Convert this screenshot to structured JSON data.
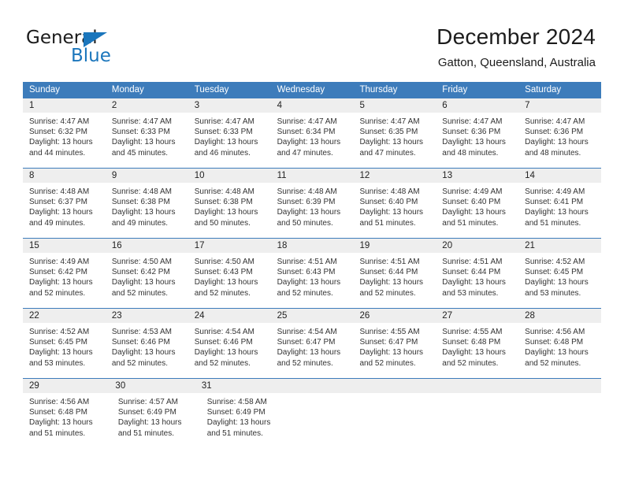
{
  "brand": {
    "name_dark": "General",
    "name_light": "Blue",
    "triangle_color": "#1b76bc",
    "dark_color": "#1a1a1a"
  },
  "header": {
    "title": "December 2024",
    "subtitle": "Gatton, Queensland, Australia"
  },
  "theme": {
    "header_blue": "#3d7cbb",
    "daynum_band": "#eeeeee",
    "text": "#222222"
  },
  "weekdays": [
    "Sunday",
    "Monday",
    "Tuesday",
    "Wednesday",
    "Thursday",
    "Friday",
    "Saturday"
  ],
  "weeks": [
    [
      {
        "day": "1",
        "sunrise": "Sunrise: 4:47 AM",
        "sunset": "Sunset: 6:32 PM",
        "daylight1": "Daylight: 13 hours",
        "daylight2": "and 44 minutes."
      },
      {
        "day": "2",
        "sunrise": "Sunrise: 4:47 AM",
        "sunset": "Sunset: 6:33 PM",
        "daylight1": "Daylight: 13 hours",
        "daylight2": "and 45 minutes."
      },
      {
        "day": "3",
        "sunrise": "Sunrise: 4:47 AM",
        "sunset": "Sunset: 6:33 PM",
        "daylight1": "Daylight: 13 hours",
        "daylight2": "and 46 minutes."
      },
      {
        "day": "4",
        "sunrise": "Sunrise: 4:47 AM",
        "sunset": "Sunset: 6:34 PM",
        "daylight1": "Daylight: 13 hours",
        "daylight2": "and 47 minutes."
      },
      {
        "day": "5",
        "sunrise": "Sunrise: 4:47 AM",
        "sunset": "Sunset: 6:35 PM",
        "daylight1": "Daylight: 13 hours",
        "daylight2": "and 47 minutes."
      },
      {
        "day": "6",
        "sunrise": "Sunrise: 4:47 AM",
        "sunset": "Sunset: 6:36 PM",
        "daylight1": "Daylight: 13 hours",
        "daylight2": "and 48 minutes."
      },
      {
        "day": "7",
        "sunrise": "Sunrise: 4:47 AM",
        "sunset": "Sunset: 6:36 PM",
        "daylight1": "Daylight: 13 hours",
        "daylight2": "and 48 minutes."
      }
    ],
    [
      {
        "day": "8",
        "sunrise": "Sunrise: 4:48 AM",
        "sunset": "Sunset: 6:37 PM",
        "daylight1": "Daylight: 13 hours",
        "daylight2": "and 49 minutes."
      },
      {
        "day": "9",
        "sunrise": "Sunrise: 4:48 AM",
        "sunset": "Sunset: 6:38 PM",
        "daylight1": "Daylight: 13 hours",
        "daylight2": "and 49 minutes."
      },
      {
        "day": "10",
        "sunrise": "Sunrise: 4:48 AM",
        "sunset": "Sunset: 6:38 PM",
        "daylight1": "Daylight: 13 hours",
        "daylight2": "and 50 minutes."
      },
      {
        "day": "11",
        "sunrise": "Sunrise: 4:48 AM",
        "sunset": "Sunset: 6:39 PM",
        "daylight1": "Daylight: 13 hours",
        "daylight2": "and 50 minutes."
      },
      {
        "day": "12",
        "sunrise": "Sunrise: 4:48 AM",
        "sunset": "Sunset: 6:40 PM",
        "daylight1": "Daylight: 13 hours",
        "daylight2": "and 51 minutes."
      },
      {
        "day": "13",
        "sunrise": "Sunrise: 4:49 AM",
        "sunset": "Sunset: 6:40 PM",
        "daylight1": "Daylight: 13 hours",
        "daylight2": "and 51 minutes."
      },
      {
        "day": "14",
        "sunrise": "Sunrise: 4:49 AM",
        "sunset": "Sunset: 6:41 PM",
        "daylight1": "Daylight: 13 hours",
        "daylight2": "and 51 minutes."
      }
    ],
    [
      {
        "day": "15",
        "sunrise": "Sunrise: 4:49 AM",
        "sunset": "Sunset: 6:42 PM",
        "daylight1": "Daylight: 13 hours",
        "daylight2": "and 52 minutes."
      },
      {
        "day": "16",
        "sunrise": "Sunrise: 4:50 AM",
        "sunset": "Sunset: 6:42 PM",
        "daylight1": "Daylight: 13 hours",
        "daylight2": "and 52 minutes."
      },
      {
        "day": "17",
        "sunrise": "Sunrise: 4:50 AM",
        "sunset": "Sunset: 6:43 PM",
        "daylight1": "Daylight: 13 hours",
        "daylight2": "and 52 minutes."
      },
      {
        "day": "18",
        "sunrise": "Sunrise: 4:51 AM",
        "sunset": "Sunset: 6:43 PM",
        "daylight1": "Daylight: 13 hours",
        "daylight2": "and 52 minutes."
      },
      {
        "day": "19",
        "sunrise": "Sunrise: 4:51 AM",
        "sunset": "Sunset: 6:44 PM",
        "daylight1": "Daylight: 13 hours",
        "daylight2": "and 52 minutes."
      },
      {
        "day": "20",
        "sunrise": "Sunrise: 4:51 AM",
        "sunset": "Sunset: 6:44 PM",
        "daylight1": "Daylight: 13 hours",
        "daylight2": "and 53 minutes."
      },
      {
        "day": "21",
        "sunrise": "Sunrise: 4:52 AM",
        "sunset": "Sunset: 6:45 PM",
        "daylight1": "Daylight: 13 hours",
        "daylight2": "and 53 minutes."
      }
    ],
    [
      {
        "day": "22",
        "sunrise": "Sunrise: 4:52 AM",
        "sunset": "Sunset: 6:45 PM",
        "daylight1": "Daylight: 13 hours",
        "daylight2": "and 53 minutes."
      },
      {
        "day": "23",
        "sunrise": "Sunrise: 4:53 AM",
        "sunset": "Sunset: 6:46 PM",
        "daylight1": "Daylight: 13 hours",
        "daylight2": "and 52 minutes."
      },
      {
        "day": "24",
        "sunrise": "Sunrise: 4:54 AM",
        "sunset": "Sunset: 6:46 PM",
        "daylight1": "Daylight: 13 hours",
        "daylight2": "and 52 minutes."
      },
      {
        "day": "25",
        "sunrise": "Sunrise: 4:54 AM",
        "sunset": "Sunset: 6:47 PM",
        "daylight1": "Daylight: 13 hours",
        "daylight2": "and 52 minutes."
      },
      {
        "day": "26",
        "sunrise": "Sunrise: 4:55 AM",
        "sunset": "Sunset: 6:47 PM",
        "daylight1": "Daylight: 13 hours",
        "daylight2": "and 52 minutes."
      },
      {
        "day": "27",
        "sunrise": "Sunrise: 4:55 AM",
        "sunset": "Sunset: 6:48 PM",
        "daylight1": "Daylight: 13 hours",
        "daylight2": "and 52 minutes."
      },
      {
        "day": "28",
        "sunrise": "Sunrise: 4:56 AM",
        "sunset": "Sunset: 6:48 PM",
        "daylight1": "Daylight: 13 hours",
        "daylight2": "and 52 minutes."
      }
    ],
    [
      {
        "day": "29",
        "sunrise": "Sunrise: 4:56 AM",
        "sunset": "Sunset: 6:48 PM",
        "daylight1": "Daylight: 13 hours",
        "daylight2": "and 51 minutes."
      },
      {
        "day": "30",
        "sunrise": "Sunrise: 4:57 AM",
        "sunset": "Sunset: 6:49 PM",
        "daylight1": "Daylight: 13 hours",
        "daylight2": "and 51 minutes."
      },
      {
        "day": "31",
        "sunrise": "Sunrise: 4:58 AM",
        "sunset": "Sunset: 6:49 PM",
        "daylight1": "Daylight: 13 hours",
        "daylight2": "and 51 minutes."
      },
      null,
      null,
      null,
      null
    ]
  ]
}
